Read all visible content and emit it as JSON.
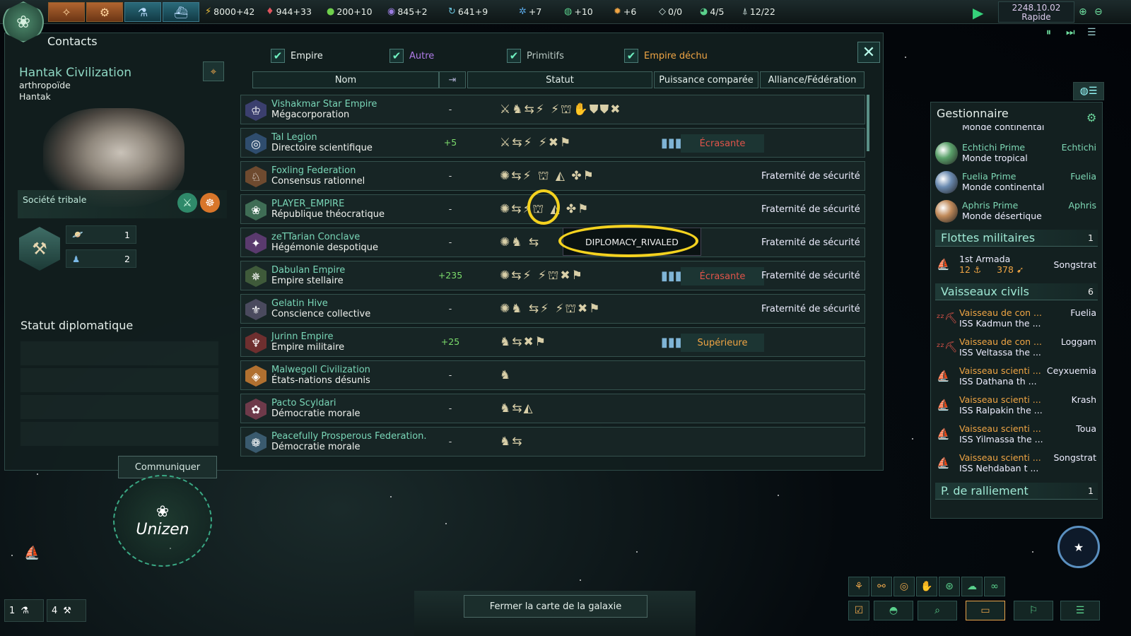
{
  "topbar": {
    "resources": [
      {
        "icon": "energy-icon",
        "glyph": "⚡",
        "value": "8000+42",
        "color": "#f3c33a"
      },
      {
        "icon": "minerals-icon",
        "glyph": "♦",
        "value": "944+33",
        "color": "#e0545e"
      },
      {
        "icon": "food-icon",
        "glyph": "●",
        "value": "200+10",
        "color": "#6fd04c"
      },
      {
        "icon": "influence-icon",
        "glyph": "◉",
        "value": "845+2",
        "color": "#9a7ce0"
      },
      {
        "icon": "unity-icon",
        "glyph": "↻",
        "value": "641+9",
        "color": "#6cc6e0"
      },
      {
        "icon": "physics-icon",
        "glyph": "✲",
        "value": "+7",
        "color": "#5aa8e6"
      },
      {
        "icon": "society-icon",
        "glyph": "◍",
        "value": "+10",
        "color": "#5ad08c"
      },
      {
        "icon": "engineering-icon",
        "glyph": "✹",
        "value": "+6",
        "color": "#f0a544"
      },
      {
        "icon": "strategic-icon",
        "glyph": "◇",
        "value": "0/0",
        "color": "#cfe3df"
      },
      {
        "icon": "planets-icon",
        "glyph": "◕",
        "value": "4/5",
        "color": "#5ad08c"
      },
      {
        "icon": "fleet-cap-icon",
        "glyph": "⍋",
        "value": "12/22",
        "color": "#cfe3df"
      }
    ],
    "date": "2248.10.02",
    "speed": "Rapide"
  },
  "contacts": {
    "title": "Contacts",
    "filters": [
      {
        "label": "Empire",
        "color": "#e8f0ec"
      },
      {
        "label": "Autre",
        "color": "#b07ce8"
      },
      {
        "label": "Primitifs",
        "color": "#b9c8c3"
      },
      {
        "label": "Empire déchu",
        "color": "#f0a544"
      }
    ],
    "columns": {
      "name": "Nom",
      "status": "Statut",
      "power": "Puissance comparée",
      "alliance": "Alliance/Fédération"
    },
    "selected": {
      "name": "Hantak Civilization",
      "species_class": "arthropoïde",
      "species": "Hantak",
      "society": "Société tribale",
      "planets": "1",
      "pops": "2"
    },
    "diplomatic_status_title": "Statut diplomatique",
    "communicate_label": "Communiquer",
    "rows": [
      {
        "name": "Vishakmar Star Empire",
        "gov": "Mégacorporation",
        "opinion": "-",
        "positive": false,
        "status": "⚔♞⇆⚡ ⚡⛫✋⛊⛊✖",
        "bars": false,
        "power": "",
        "power_class": "",
        "alliance": "",
        "icon": "vishakmar-emblem-icon",
        "glyph": "♔",
        "bg": "#3b3f6e"
      },
      {
        "name": "Tal Legion",
        "gov": "Directoire scientifique",
        "opinion": "+5",
        "positive": true,
        "status": "⚔⇆⚡ ⚡✖⚑",
        "bars": true,
        "power": "Écrasante",
        "power_class": "red",
        "alliance": "",
        "icon": "tal-legion-emblem-icon",
        "glyph": "◎",
        "bg": "#2f4d6e"
      },
      {
        "name": "Foxling Federation",
        "gov": "Consensus rationnel",
        "opinion": "-",
        "positive": false,
        "status": "✺⇆⚡ ⛫ ◭ ✤⚑",
        "bars": false,
        "power": "",
        "power_class": "",
        "alliance": "Fraternité de sécurité",
        "icon": "foxling-emblem-icon",
        "glyph": "♘",
        "bg": "#6e4a2f"
      },
      {
        "name": "PLAYER_EMPIRE",
        "gov": "République théocratique",
        "opinion": "-",
        "positive": false,
        "status": "✺⇆⚡⛫ ◭ ✤⚑",
        "bars": false,
        "power": "",
        "power_class": "",
        "alliance": "Fraternité de sécurité",
        "icon": "player-empire-emblem-icon",
        "glyph": "❀",
        "bg": "#3f6d55"
      },
      {
        "name": "zeTTarian Conclave",
        "gov": "Hégémonie despotique",
        "opinion": "-",
        "positive": false,
        "status": "✺♞ ⇆",
        "bars": false,
        "power": "",
        "power_class": "",
        "alliance": "Fraternité de sécurité",
        "icon": "zettarian-emblem-icon",
        "glyph": "✦",
        "bg": "#5a3a6e"
      },
      {
        "name": "Dabulan Empire",
        "gov": "Empire stellaire",
        "opinion": "+235",
        "positive": true,
        "status": "✺⇆⚡ ⚡⛫✖⚑",
        "bars": true,
        "power": "Écrasante",
        "power_class": "red",
        "alliance": "Fraternité de sécurité",
        "icon": "dabulan-emblem-icon",
        "glyph": "✵",
        "bg": "#3f5a3a"
      },
      {
        "name": "Gelatin Hive",
        "gov": "Conscience collective",
        "opinion": "-",
        "positive": false,
        "status": "✺♞ ⇆⚡ ⚡⛫✖⚑",
        "bars": false,
        "power": "",
        "power_class": "",
        "alliance": "Fraternité de sécurité",
        "icon": "gelatin-emblem-icon",
        "glyph": "⚜",
        "bg": "#4a4a5e"
      },
      {
        "name": "Jurinn Empire",
        "gov": "Empire militaire",
        "opinion": "+25",
        "positive": true,
        "status": "♞⇆✖⚑",
        "bars": true,
        "power": "Supérieure",
        "power_class": "orange",
        "alliance": "",
        "icon": "jurinn-emblem-icon",
        "glyph": "♆",
        "bg": "#6e2f2f"
      },
      {
        "name": "Malwegoll Civilization",
        "gov": "États-nations désunis",
        "opinion": "-",
        "positive": false,
        "status": "♞",
        "bars": false,
        "power": "",
        "power_class": "",
        "alliance": "",
        "icon": "malwegoll-emblem-icon",
        "glyph": "◈",
        "bg": "#b07030"
      },
      {
        "name": "Pacto Scyldari",
        "gov": "Démocratie morale",
        "opinion": "-",
        "positive": false,
        "status": "♞⇆◭",
        "bars": false,
        "power": "",
        "power_class": "",
        "alliance": "",
        "icon": "pacto-emblem-icon",
        "glyph": "✿",
        "bg": "#6e3a4a"
      },
      {
        "name": "Peacefully Prosperous Federation.",
        "gov": "Démocratie morale",
        "opinion": "-",
        "positive": false,
        "status": "♞⇆",
        "bars": false,
        "power": "",
        "power_class": "",
        "alliance": "",
        "icon": "peaceful-emblem-icon",
        "glyph": "❁",
        "bg": "#3a5a6e"
      }
    ],
    "tooltip": "DIPLOMACY_RIVALED"
  },
  "manager": {
    "title": "Gestionnaire",
    "partial_planet_type": "Monde continental",
    "planets": [
      {
        "name": "Echtichi Prime",
        "type": "Monde tropical",
        "system": "Echtichi",
        "color": "#5aa06a"
      },
      {
        "name": "Fuelia Prime",
        "type": "Monde continental",
        "system": "Fuelia",
        "color": "#6a8ab0"
      },
      {
        "name": "Aphris Prime",
        "type": "Monde désertique",
        "system": "Aphris",
        "color": "#c08a5a"
      }
    ],
    "military": {
      "title": "Flottes militaires",
      "count": "1",
      "fleet_name": "1st Armada",
      "ships": "12",
      "power": "378",
      "location": "Songstrat"
    },
    "civilian": {
      "title": "Vaisseaux civils",
      "count": "6",
      "ships": [
        {
          "l1": "Vaisseau de con ...",
          "l2": "ISS Kadmun the ...",
          "loc": "Fuelia",
          "icon": "construction-ship-icon"
        },
        {
          "l1": "Vaisseau de con ...",
          "l2": "ISS Veltassa the ...",
          "loc": "Loggam",
          "icon": "construction-ship-icon"
        },
        {
          "l1": "Vaisseau scienti ...",
          "l2": "ISS Dathana th ...",
          "loc": "Ceyxuemia",
          "icon": "science-ship-icon"
        },
        {
          "l1": "Vaisseau scienti ...",
          "l2": "ISS Ralpakin the ...",
          "loc": "Krash",
          "icon": "science-ship-icon"
        },
        {
          "l1": "Vaisseau scienti ...",
          "l2": "ISS Yilmassa the ...",
          "loc": "Toua",
          "icon": "science-ship-icon"
        },
        {
          "l1": "Vaisseau scienti ...",
          "l2": "ISS Nehdaban t ...",
          "loc": "Songstrat",
          "icon": "science-ship-icon"
        }
      ]
    },
    "rally": {
      "title": "P. de ralliement",
      "count": "1"
    }
  },
  "map": {
    "system_name": "Unizen",
    "close_map_label": "Fermer la carte de la galaxie",
    "chip1": "1",
    "chip2": "4"
  }
}
